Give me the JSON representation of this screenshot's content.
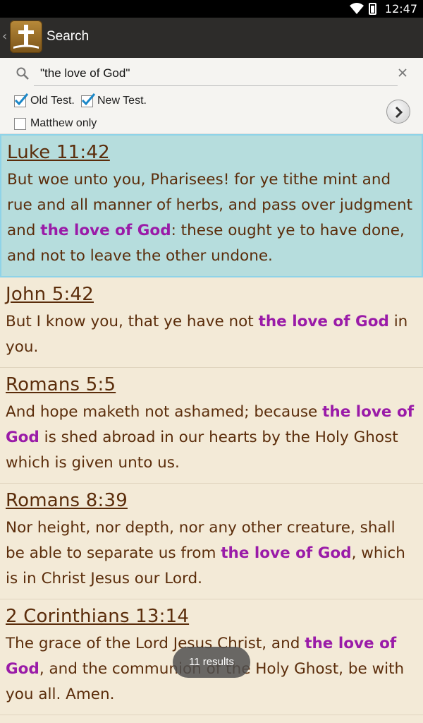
{
  "status_bar": {
    "time": "12:47"
  },
  "action_bar": {
    "title": "Search"
  },
  "search": {
    "query": "\"the love of God\"",
    "options": [
      {
        "label": "Old Test.",
        "checked": true
      },
      {
        "label": "New Test.",
        "checked": true
      },
      {
        "label": "Matthew only",
        "checked": false
      }
    ]
  },
  "results": [
    {
      "ref": "Luke 11:42",
      "before": "But woe unto you, Pharisees! for ye tithe mint and rue and all manner of herbs, and pass over judgment and ",
      "highlight": "the love of God",
      "after": ": these ought ye to have done, and not to leave the other undone."
    },
    {
      "ref": "John 5:42",
      "before": "But I know you, that ye have not ",
      "highlight": "the love of God",
      "after": " in you."
    },
    {
      "ref": "Romans 5:5",
      "before": "And hope maketh not ashamed; because ",
      "highlight": "the love of God",
      "after": " is shed abroad in our hearts by the Holy Ghost which is given unto us."
    },
    {
      "ref": "Romans 8:39",
      "before": "Nor height, nor depth, nor any other creature, shall be able to separate us from ",
      "highlight": "the love of God",
      "after": ", which is in Christ Jesus our Lord."
    },
    {
      "ref": "2 Corinthians 13:14",
      "before": "The grace of the Lord Jesus Christ, and ",
      "highlight": "the love of God",
      "after": ", and the communion of the Holy Ghost, be with you all. Amen."
    }
  ],
  "toast": {
    "text": "11 results"
  },
  "colors": {
    "background": "#f3ead7",
    "selected": "#b6dddd",
    "highlight": "#9a1ba8",
    "text": "#5b2d0b"
  }
}
